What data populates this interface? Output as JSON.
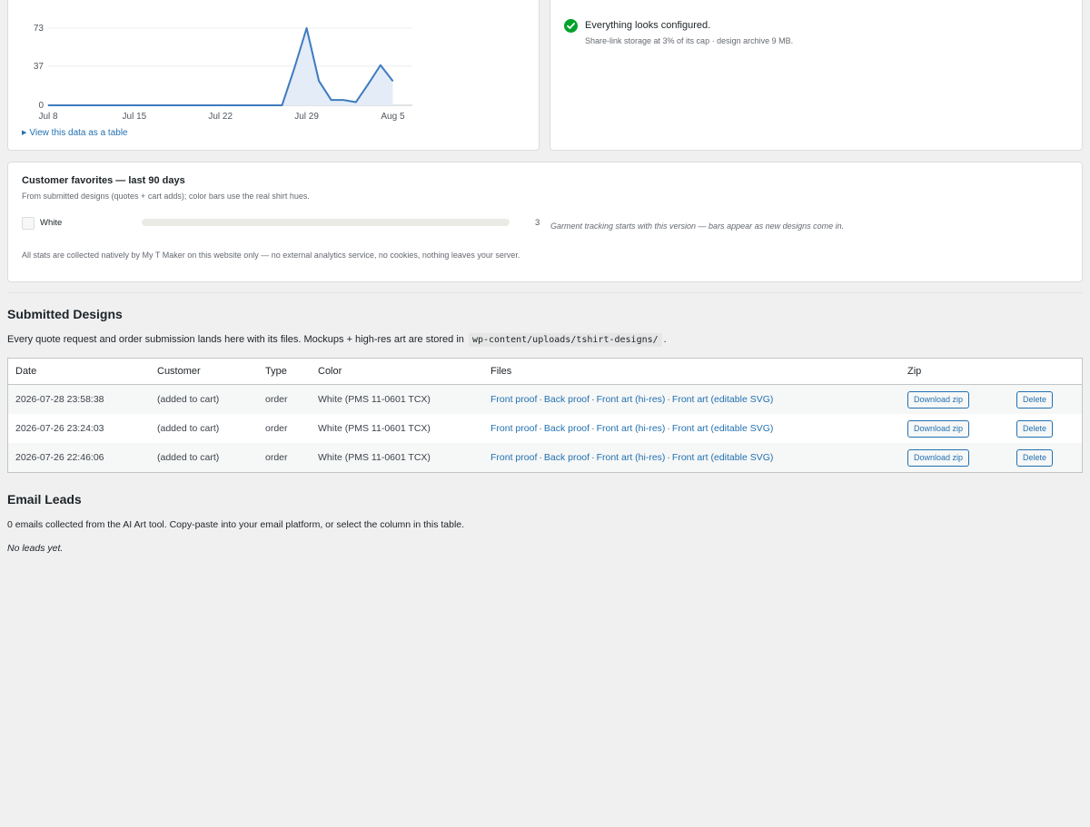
{
  "chart_data": {
    "type": "area",
    "x": [
      "Jul 8",
      "Jul 9",
      "Jul 10",
      "Jul 11",
      "Jul 12",
      "Jul 13",
      "Jul 14",
      "Jul 15",
      "Jul 16",
      "Jul 17",
      "Jul 18",
      "Jul 19",
      "Jul 20",
      "Jul 21",
      "Jul 22",
      "Jul 23",
      "Jul 24",
      "Jul 25",
      "Jul 26",
      "Jul 27",
      "Jul 28",
      "Jul 29",
      "Jul 30",
      "Jul 31",
      "Aug 1",
      "Aug 2",
      "Aug 3",
      "Aug 4",
      "Aug 5",
      "Aug 6"
    ],
    "values": [
      0,
      0,
      0,
      0,
      0,
      0,
      0,
      0,
      0,
      0,
      0,
      0,
      0,
      0,
      0,
      0,
      0,
      0,
      0,
      0,
      35,
      73,
      23,
      5,
      5,
      3,
      20,
      38,
      23,
      null
    ],
    "y_ticks": [
      "73",
      "37",
      "0"
    ],
    "x_ticks": [
      "Jul 8",
      "Jul 15",
      "Jul 22",
      "Jul 29",
      "Aug 5"
    ],
    "ylim": [
      0,
      73
    ],
    "colors": {
      "line": "#3e7bbf",
      "fill": "#e3ecf7",
      "grid": "#e9ecef"
    }
  },
  "chart_card": {
    "table_toggle": "View this data as a table"
  },
  "status": {
    "title": "Everything looks configured.",
    "subtitle": "Share-link storage at 3% of its cap · design archive 9 MB."
  },
  "favorites": {
    "title": "Customer favorites — last 90 days",
    "subtitle": "From submitted designs (quotes + cart adds); color bars use the real shirt hues.",
    "items": [
      {
        "label": "White",
        "count": "3",
        "share": 1.0,
        "color": "#ebebe6"
      }
    ],
    "note": "Garment tracking starts with this version — bars appear as new designs come in.",
    "footer": "All stats are collected natively by My T Maker on this website only — no external analytics service, no cookies, nothing leaves your server."
  },
  "designs": {
    "heading": "Submitted Designs",
    "desc_before": "Every quote request and order submission lands here with its files. Mockups + high-res art are stored in",
    "desc_path": "wp-content/uploads/tshirt-designs/",
    "desc_after": ".",
    "columns": [
      "Date",
      "Customer",
      "Type",
      "Color",
      "Files",
      "Zip",
      ""
    ],
    "rows": [
      {
        "date": "2026-07-28 23:58:38",
        "customer": "(added to cart)",
        "type": "order",
        "color": "White (PMS 11-0601 TCX)",
        "files": [
          "Front proof",
          "Back proof",
          "Front art (hi-res)",
          "Front art (editable SVG)"
        ],
        "zip": "Download zip",
        "delete": "Delete"
      },
      {
        "date": "2026-07-26 23:24:03",
        "customer": "(added to cart)",
        "type": "order",
        "color": "White (PMS 11-0601 TCX)",
        "files": [
          "Front proof",
          "Back proof",
          "Front art (hi-res)",
          "Front art (editable SVG)"
        ],
        "zip": "Download zip",
        "delete": "Delete"
      },
      {
        "date": "2026-07-26 22:46:06",
        "customer": "(added to cart)",
        "type": "order",
        "color": "White (PMS 11-0601 TCX)",
        "files": [
          "Front proof",
          "Back proof",
          "Front art (hi-res)",
          "Front art (editable SVG)"
        ],
        "zip": "Download zip",
        "delete": "Delete"
      }
    ],
    "separator": "·"
  },
  "leads": {
    "heading": "Email Leads",
    "desc": "0 emails collected from the AI Art tool. Copy-paste into your email platform, or select the column in this table.",
    "empty": "No leads yet."
  }
}
